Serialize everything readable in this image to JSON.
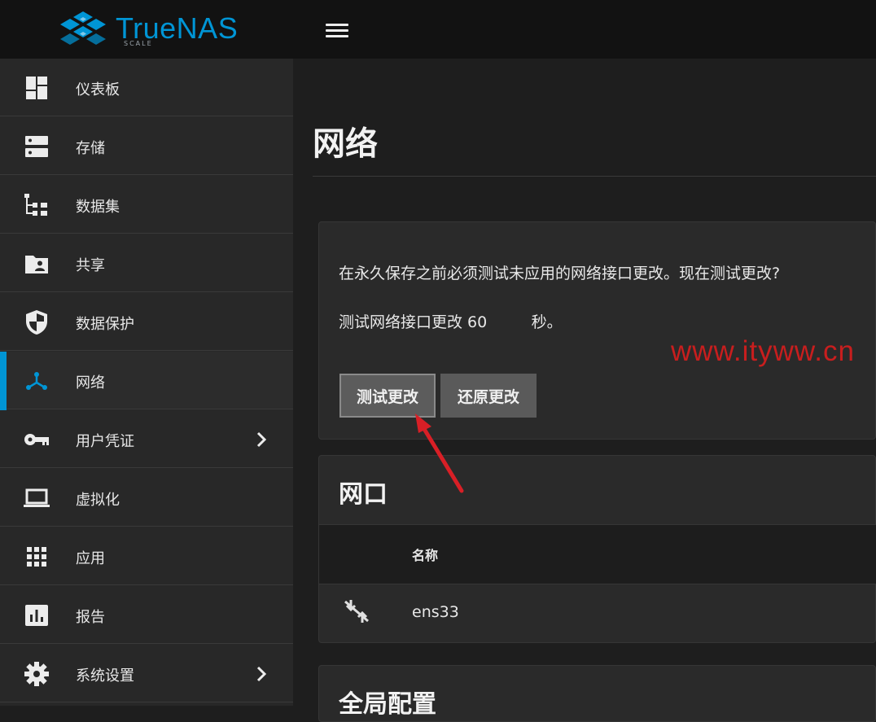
{
  "app": {
    "logo_text": "TrueNAS",
    "logo_sub": "SCALE"
  },
  "sidebar": {
    "items": [
      {
        "label": "仪表板",
        "icon": "dashboard-icon"
      },
      {
        "label": "存储",
        "icon": "storage-icon"
      },
      {
        "label": "数据集",
        "icon": "dataset-tree-icon"
      },
      {
        "label": "共享",
        "icon": "shared-folder-icon"
      },
      {
        "label": "数据保护",
        "icon": "shield-icon"
      },
      {
        "label": "网络",
        "icon": "network-icon",
        "active": true
      },
      {
        "label": "用户凭证",
        "icon": "key-icon",
        "expandable": true
      },
      {
        "label": "虚拟化",
        "icon": "laptop-icon"
      },
      {
        "label": "应用",
        "icon": "apps-grid-icon"
      },
      {
        "label": "报告",
        "icon": "report-chart-icon"
      },
      {
        "label": "系统设置",
        "icon": "gear-icon",
        "expandable": true
      }
    ]
  },
  "main": {
    "title": "网络",
    "pending_card": {
      "message": "在永久保存之前必须测试未应用的网络接口更改。现在测试更改?",
      "countdown": "测试网络接口更改 60         秒。",
      "test_button": "测试更改",
      "revert_button": "还原更改"
    },
    "interfaces_card": {
      "title": "网口",
      "column_name": "名称",
      "rows": [
        {
          "name": "ens33",
          "icon": "link-disconnected-icon"
        }
      ]
    },
    "global_config_card": {
      "title": "全局配置"
    }
  },
  "watermark": "www.ityww.cn",
  "colors": {
    "accent": "#0095d5",
    "sidebar_bg": "#282828",
    "topbar_bg": "#121212",
    "annotation_arrow": "#d81f26"
  }
}
